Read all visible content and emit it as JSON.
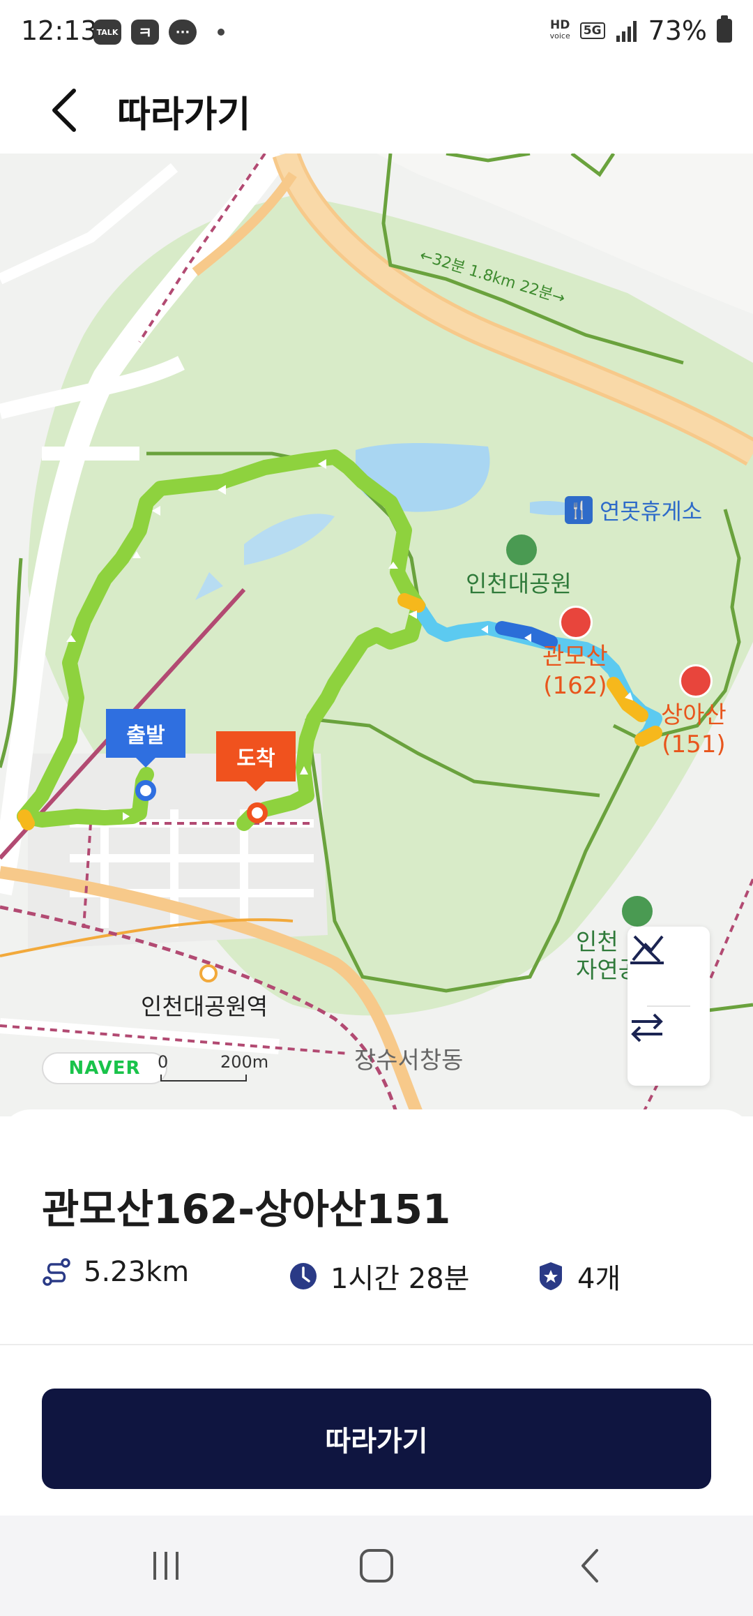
{
  "status_bar": {
    "time": "12:13",
    "notifications": [
      "talk-icon",
      "kakaobank-icon",
      "chat-icon"
    ],
    "badge_talk": "TALK",
    "hd_label": "HD",
    "voice_label": "voice",
    "network": "5G",
    "battery": "73%"
  },
  "app_bar": {
    "title": "따라가기"
  },
  "map": {
    "colors": {
      "park": "#d8ebc8",
      "route_green": "#8ed23e",
      "route_sky": "#5ccaf0",
      "route_blue": "#2b6ed8",
      "route_orange": "#f6b81c",
      "highway": "#f7c98a",
      "rail": "#b24a72",
      "water": "#a9d6f2",
      "trail": "#6aa23d"
    },
    "labels": {
      "walk_time": "←32분 1.8km 22분→",
      "rest_area": "연못휴게소",
      "park": "인천대공원",
      "peak1_name": "관모산",
      "peak1_height": "(162)",
      "peak2_name": "상아산",
      "peak2_height": "(151)",
      "nature_park_line1": "인천",
      "nature_park_line2": "자연공",
      "station": "인천대공원역",
      "district": "장수서창동"
    },
    "markers": {
      "start": "출발",
      "end": "도착"
    },
    "naver_logo": "NAVER",
    "scale_start": "0",
    "scale_end": "200m",
    "tools": [
      "elevation-toggle-icon",
      "reverse-route-icon"
    ]
  },
  "route": {
    "title": "관모산162-상아산151",
    "distance": "5.23km",
    "duration": "1시간 28분",
    "peaks": "4개"
  },
  "cta": {
    "label": "따라가기"
  },
  "nav": {
    "items": [
      "recent-apps-icon",
      "home-icon",
      "back-icon"
    ]
  }
}
